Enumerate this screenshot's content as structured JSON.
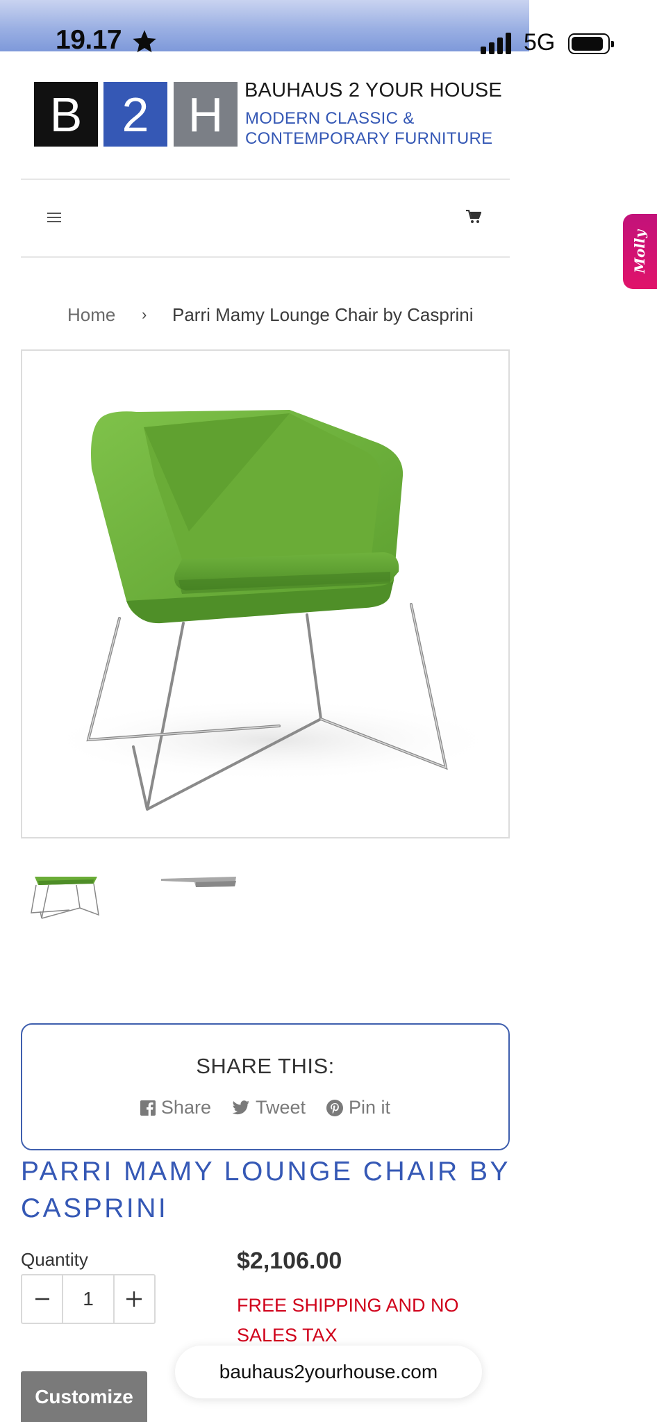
{
  "status_bar": {
    "time": "19.17",
    "network": "5G"
  },
  "brand": {
    "logo_letters": [
      "B",
      "2",
      "H"
    ],
    "name": "BAUHAUS 2 YOUR HOUSE",
    "tagline_line1": "MODERN CLASSIC &",
    "tagline_line2": "CONTEMPORARY FURNITURE",
    "colors": {
      "blue": "#3558b5",
      "black": "#111111",
      "gray": "#7b7f86"
    }
  },
  "nav": {
    "menu_icon": "hamburger-menu-icon",
    "cart_icon": "cart-icon"
  },
  "breadcrumb": {
    "home": "Home",
    "separator": "›",
    "current": "Parri Mamy Lounge Chair by Casprini"
  },
  "share": {
    "title": "SHARE THIS:",
    "facebook": "Share",
    "twitter": "Tweet",
    "pinterest": "Pin it"
  },
  "product": {
    "title": "PARRI MAMY LOUNGE CHAIR BY CASPRINI",
    "quantity_label": "Quantity",
    "quantity_value": "1",
    "price": "$2,106.00",
    "shipping_note": "FREE SHIPPING AND NO SALES TAX",
    "customize_label": "Customize",
    "shipping_color": "#d0021b"
  },
  "browser": {
    "url": "bauhaus2yourhouse.com"
  },
  "chat_widget": {
    "label": "Molly"
  }
}
